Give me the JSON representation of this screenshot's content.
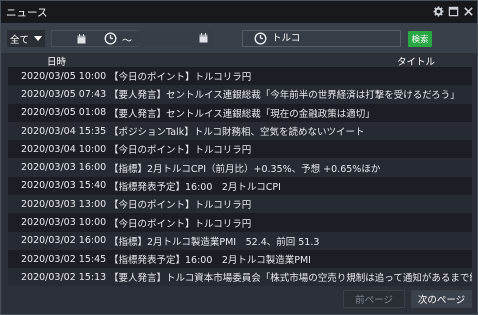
{
  "window": {
    "title": "ニュース",
    "icons": [
      "gear-icon",
      "minimize-icon",
      "close-icon"
    ]
  },
  "filters": {
    "scope_label": "全て",
    "tilde": "～",
    "keyword": "トルコ",
    "search_label": "検索",
    "search_color": "#2aa745"
  },
  "table": {
    "col_datetime": "日時",
    "col_title": "タイトル",
    "rows": [
      {
        "datetime": "2020/03/05 10:00",
        "title": "【今日のポイント】トルコリラ円"
      },
      {
        "datetime": "2020/03/05 07:43",
        "title": "【要人発言】セントルイス連銀総裁「今年前半の世界経済は打撃を受けるだろう」"
      },
      {
        "datetime": "2020/03/05 01:08",
        "title": "【要人発言】セントルイス連銀総裁「現在の金融政策は適切」"
      },
      {
        "datetime": "2020/03/04 15:35",
        "title": "【ポジションTalk】トルコ財務相、空気を読めないツイート"
      },
      {
        "datetime": "2020/03/04 10:00",
        "title": "【今日のポイント】トルコリラ円"
      },
      {
        "datetime": "2020/03/03 16:00",
        "title": "【指標】2月トルコCPI（前月比）+0.35%、予想 +0.65%ほか"
      },
      {
        "datetime": "2020/03/03 15:40",
        "title": "【指標発表予定】16:00　2月トルコCPI"
      },
      {
        "datetime": "2020/03/03 13:00",
        "title": "【今日のポイント】トルコリラ円"
      },
      {
        "datetime": "2020/03/03 10:00",
        "title": "【今日のポイント】トルコリラ円"
      },
      {
        "datetime": "2020/03/02 16:00",
        "title": "【指標】2月トルコ製造業PMI　52.4、前回 51.3"
      },
      {
        "datetime": "2020/03/02 15:45",
        "title": "【指標発表予定】16:00　2月トルコ製造業PMI"
      },
      {
        "datetime": "2020/03/02 15:13",
        "title": "【要人発言】トルコ資本市場委員会「株式市場の空売り規制は追って通知があるまで継続」"
      }
    ]
  },
  "pagination": {
    "prev_label": "前ページ",
    "next_label": "次のページ"
  }
}
